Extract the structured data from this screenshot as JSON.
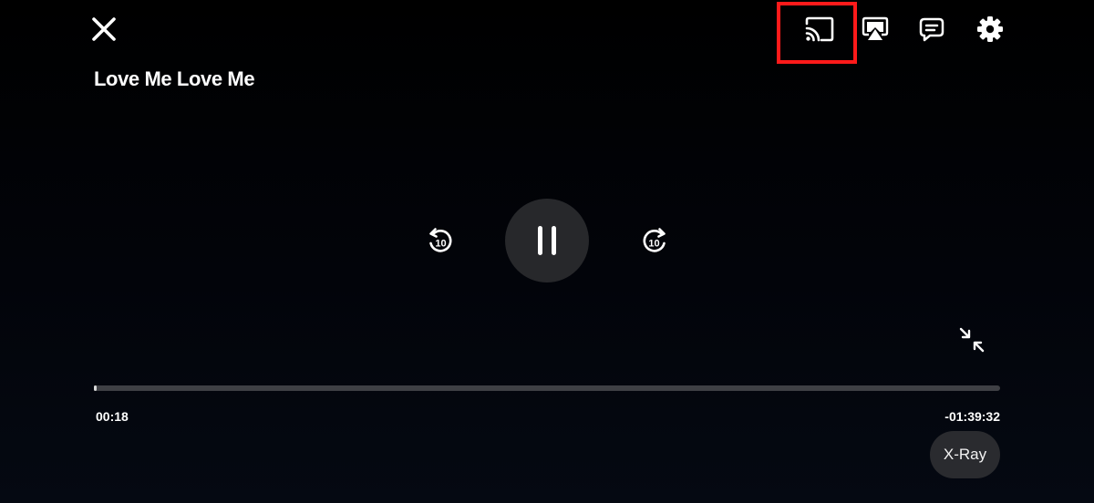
{
  "player": {
    "title": "Love Me Love Me",
    "progress_fraction": 0.003,
    "time_elapsed": "00:18",
    "time_remaining": "-01:39:32",
    "rewind_seconds": "10",
    "forward_seconds": "10",
    "xray_label": "X-Ray",
    "highlight_color": "#ff1a1a"
  },
  "icons": {
    "close": "close-icon",
    "cast": "cast-icon",
    "airplay": "airplay-icon",
    "subtitles": "subtitles-icon",
    "settings": "gear-icon",
    "rewind": "rewind-10-icon",
    "pause": "pause-icon",
    "forward": "forward-10-icon",
    "minimize": "exit-fullscreen-icon"
  }
}
